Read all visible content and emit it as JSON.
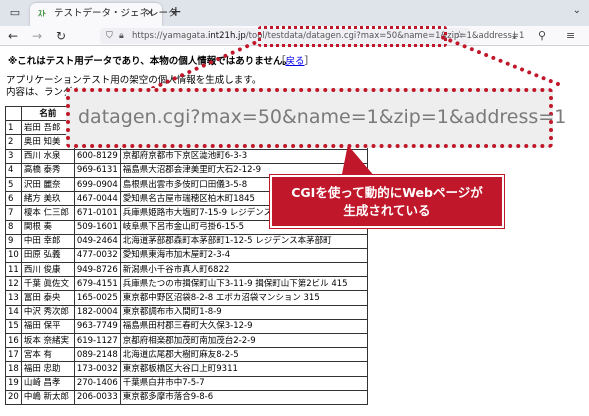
{
  "browser": {
    "tab_title": "テストデータ・ジェネレータ",
    "tab_favicon": "ｽﾄ",
    "url_prefix": "https://yamagata.",
    "url_domain": "int21h.jp",
    "url_rest": "/tool/testdata/datagen.cgi?max=50&name=1&zip=1&address=1",
    "icons": [
      "tab-list-icon",
      "close-icon",
      "new-tab-icon",
      "chevron-down-icon",
      "back-arrow-icon",
      "forward-arrow-icon",
      "reload-icon",
      "shield-icon",
      "lock-icon",
      "star-icon",
      "download-icon",
      "extensions-icon",
      "menu-icon"
    ]
  },
  "page": {
    "notice": "※これはテスト用データであり、本物の個人情報ではありません。",
    "back_bracket_open": "［",
    "back_link": "戻る",
    "back_bracket_close": "］",
    "intro_line1": "アプリケーションテスト用の架空の個人情報を生成します。",
    "intro_line2": "内容は、ランダムに",
    "table": {
      "headers": [
        "",
        "名前",
        "",
        ""
      ],
      "rows": [
        [
          "1",
          "岩田 吾郎",
          "",
          ""
        ],
        [
          "2",
          "奥田 知美",
          "",
          ""
        ],
        [
          "3",
          "西川 水泉",
          "600-8129",
          "京都府京都市下京区澁池町6-3-3"
        ],
        [
          "4",
          "高橋 泰秀",
          "969-6131",
          "福島県大沼郡会津美里町大石2-12-9"
        ],
        [
          "5",
          "沢田 麗奈",
          "699-0904",
          "島根県出雲市多伎町口田儀3-5-8"
        ],
        [
          "6",
          "緒方 美玖",
          "467-0044",
          "愛知県名古屋市瑞穂区柏木町1845"
        ],
        [
          "7",
          "榎本 仁三郎",
          "671-0101",
          "兵庫県姫路市大塩町7-15-9 レジデンス大塩町"
        ],
        [
          "8",
          "関根 奏",
          "509-1601",
          "岐阜県下呂市金山町弓掛6-15-5"
        ],
        [
          "9",
          "中田 幸郎",
          "049-2464",
          "北海道茅部郡森町本茅部町1-12-5 レジデンス本茅部町"
        ],
        [
          "10",
          "田原 弘義",
          "477-0032",
          "愛知県東海市加木屋町2-3-4"
        ],
        [
          "11",
          "西川 俊康",
          "949-8726",
          "新潟県小千谷市真人町6822"
        ],
        [
          "12",
          "千葉 眞佐文",
          "679-4151",
          "兵庫県たつの市揖保町山下3-11-9 揖保町山下第2ビル 415"
        ],
        [
          "13",
          "冨田 泰央",
          "165-0025",
          "東京都中野区沼袋8-2-8 エボカ沼袋マンション 315"
        ],
        [
          "14",
          "中沢 秀次郎",
          "182-0004",
          "東京都調布市入間町1-8-9"
        ],
        [
          "15",
          "福田 保平",
          "963-7749",
          "福島県田村郡三春町大久保3-12-9"
        ],
        [
          "16",
          "坂本 奈緒実",
          "619-1127",
          "京都府相楽郡加茂町南加茂台2-2-9"
        ],
        [
          "17",
          "宮本 有",
          "089-2148",
          "北海道広尾郡大樹町麻友8-2-5"
        ],
        [
          "18",
          "福田 忠助",
          "173-0032",
          "東京都板橋区大谷口上町9311"
        ],
        [
          "19",
          "山崎 昌孝",
          "270-1406",
          "千葉県白井市中7-5-7"
        ],
        [
          "20",
          "中嶋 新太郎",
          "206-0033",
          "東京都多摩市落合9-8-6"
        ]
      ]
    }
  },
  "annotation": {
    "zoom_text": "datagen.cgi?max=50&name=1&zip=1&address=1",
    "callout_line1": "CGIを使って動的にWebページが",
    "callout_line2": "生成されている",
    "accent_color": "#c0182a"
  }
}
